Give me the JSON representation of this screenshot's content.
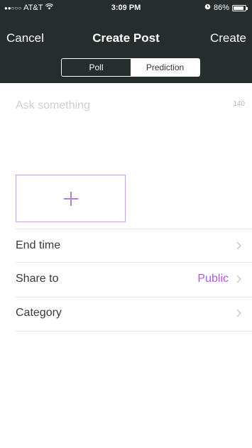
{
  "status_bar": {
    "signal": "●●○○○",
    "carrier": "AT&T",
    "time": "3:09 PM",
    "battery": "86%",
    "icons": [
      "signal-icon",
      "wifi-icon",
      "alarm-icon",
      "battery-icon"
    ]
  },
  "nav": {
    "cancel_label": "Cancel",
    "title": "Create Post",
    "create_label": "Create"
  },
  "tabs": {
    "poll_label": "Poll",
    "prediction_label": "Prediction",
    "selected": "Prediction"
  },
  "question": {
    "placeholder": "Ask something",
    "value": "",
    "char_limit": "140"
  },
  "add_option": {
    "icon": "plus-icon",
    "accent_color": "#b57fd8"
  },
  "settings": {
    "end_time_label": "End time",
    "share_to_label": "Share to",
    "share_to_value": "Public",
    "category_label": "Category"
  },
  "colors": {
    "header_bg": "#252d2d",
    "accent": "#b05bd6"
  }
}
